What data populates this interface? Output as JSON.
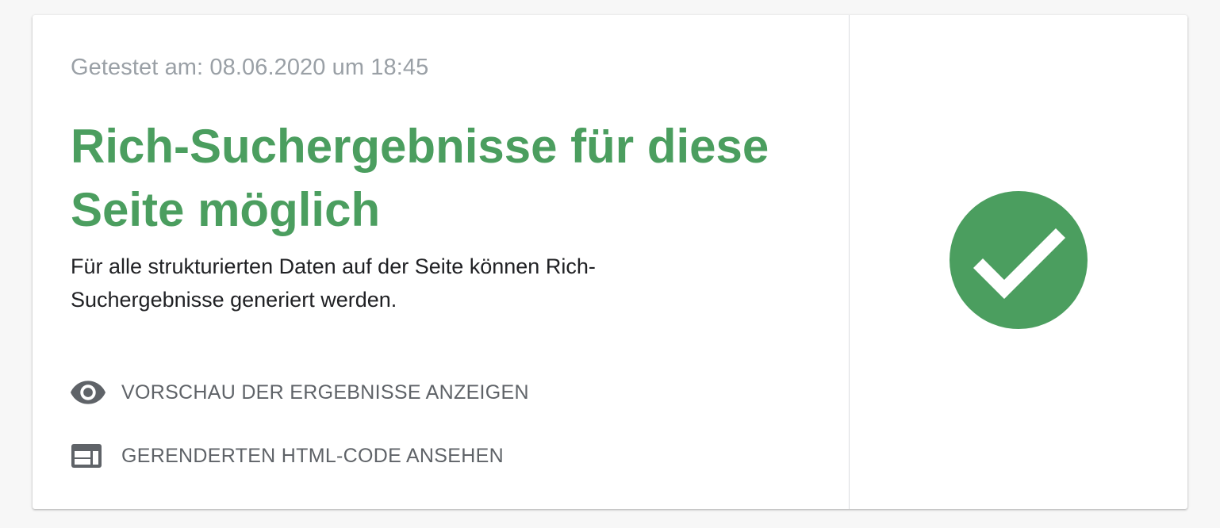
{
  "result": {
    "tested_at": "Getestet am: 08.06.2020 um 18:45",
    "title": "Rich-Suchergebnisse für diese Seite möglich",
    "description": "Für alle strukturierten Daten auf der Seite können Rich-Suchergebnisse generiert werden.",
    "status": "success",
    "status_icon": "check-circle-icon",
    "accent_color": "#4b9e5f"
  },
  "actions": [
    {
      "label": "VORSCHAU DER ERGEBNISSE ANZEIGEN",
      "icon": "eye-icon"
    },
    {
      "label": "GERENDERTEN HTML-CODE ANSEHEN",
      "icon": "web-layout-icon"
    }
  ]
}
